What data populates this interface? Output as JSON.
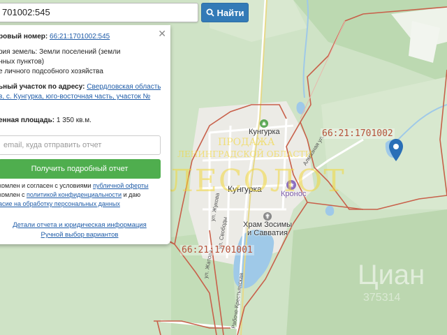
{
  "search": {
    "value": "701002:545",
    "button_label": "Найти"
  },
  "popup": {
    "cad_number_label": "ровый номер: ",
    "cad_number_link": "66:21:1701002:545",
    "category_line1": "рия земель: Земли поселений (земли",
    "category_line2": "нных пунктов)",
    "category_line3": "е личного подсобного хозяйства",
    "address_label": "ьный участок по адресу: ",
    "address_link1": "Свердловская область,",
    "address_link2": "в, с. Кунгурка, юго-восточная часть, участок №",
    "area_label": "енная площадь: ",
    "area_value": "1 350 кв.м.",
    "email_placeholder": "email, куда отправить отчет",
    "report_button": "Получить подробный отчет",
    "consent_line1_a": "комлен и согласен с условиями ",
    "consent_line1_link": "публичной оферты",
    "consent_line2_a": "комлен с ",
    "consent_line2_link": "политикой конфиденциальности",
    "consent_line2_b": " и даю",
    "consent_line3_link": "асие на обработку персональных данных",
    "details_link": "Детали отчета и юридическая информация",
    "manual_link": "Ручной выбор вариантов"
  },
  "map": {
    "places": {
      "kungurka_top": "Кунгурка",
      "kungurka_center": "Кунгурка",
      "kronos": "Кронос",
      "church_line1": "Храм Зосимы",
      "church_line2": "и Савватия"
    },
    "streets": {
      "zhukova": "ул. Жукова",
      "svobody": "ул. Свободы",
      "almaznaya": "Алмазная ул.",
      "zhatova": "ул. Жатова",
      "krestyanskaya": "Рабоче-Крестьянская",
      "top_street": "ул. Заречная"
    },
    "cadastral": {
      "block_east": "66:21:1701002",
      "block_center": "66:21:1701001"
    }
  },
  "watermarks": {
    "logo_big": "ЛЕСОЛОТ",
    "logo_line1": "ПРОДАЖА",
    "logo_line2": "ЛЕНИНГРАДСКОЙ ОБЛАСТИ",
    "cian": "Циан",
    "cian_id": "375314"
  },
  "colors": {
    "accent_blue": "#337ab7",
    "green_button": "#4fae4e",
    "cadastral_line": "#c8604a",
    "link": "#1f5ca8"
  }
}
